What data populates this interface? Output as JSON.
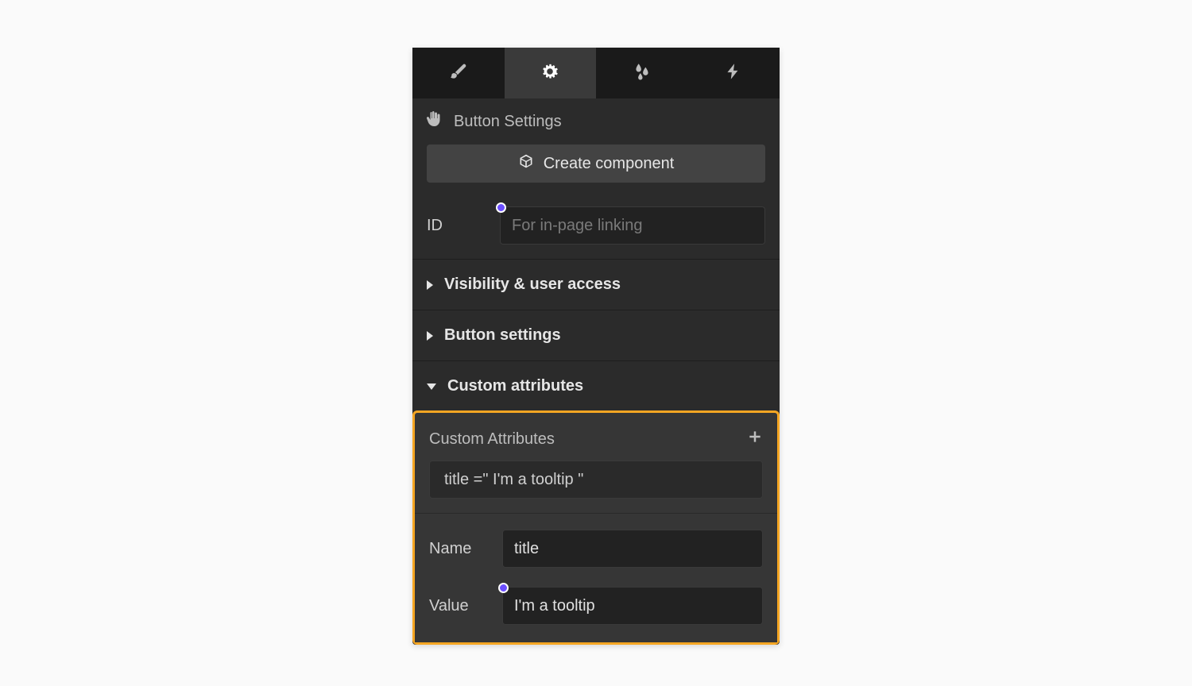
{
  "header": {
    "title": "Button Settings",
    "create_component_label": "Create component"
  },
  "id_field": {
    "label": "ID",
    "placeholder": "For in-page linking",
    "value": ""
  },
  "sections": {
    "visibility_label": "Visibility & user access",
    "button_settings_label": "Button settings",
    "custom_attributes_label": "Custom attributes"
  },
  "custom_attributes_panel": {
    "header": "Custom Attributes",
    "attribute_display": "title =\" I'm a tooltip \"",
    "name_label": "Name",
    "name_value": "title",
    "value_label": "Value",
    "value_value": "I'm a tooltip"
  }
}
